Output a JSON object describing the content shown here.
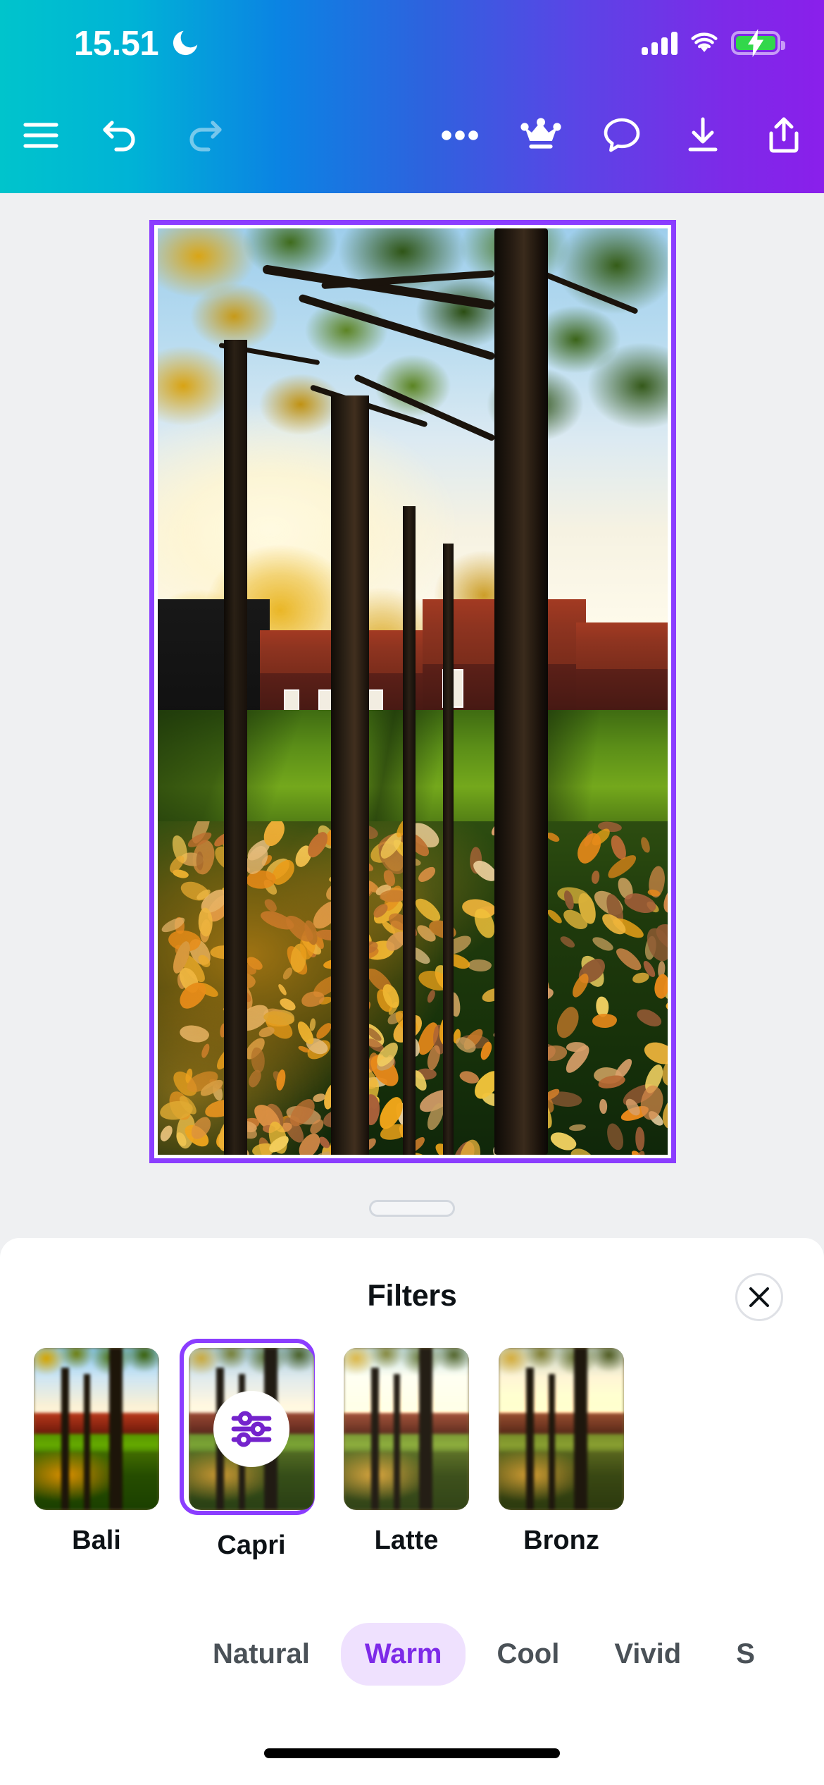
{
  "status": {
    "time": "15.51",
    "dnd_icon": "moon-icon",
    "signal_icon": "cellular-signal-icon",
    "wifi_icon": "wifi-icon",
    "battery_icon": "battery-charging-icon",
    "battery_color": "#32D74B"
  },
  "toolbar": {
    "menu_label": "menu-icon",
    "undo_label": "undo-icon",
    "redo_label": "redo-icon",
    "more_label": "more-icon",
    "crown_label": "crown-icon",
    "comment_label": "comment-icon",
    "download_label": "download-icon",
    "share_label": "share-icon"
  },
  "canvas": {
    "selection_color": "#8B3DFF",
    "background_color": "#EFF0F2",
    "image_description": "Autumn park with yellow maple leaves on grass and red-roofed houses"
  },
  "sheet": {
    "title": "Filters",
    "close_label": "✕",
    "filters": [
      {
        "name": "Bali",
        "selected": false
      },
      {
        "name": "Capri",
        "selected": true
      },
      {
        "name": "Latte",
        "selected": false
      },
      {
        "name": "Bronz",
        "selected": false
      }
    ],
    "adjust_icon": "sliders-icon",
    "categories": [
      {
        "label": "Natural",
        "active": false
      },
      {
        "label": "Warm",
        "active": true
      },
      {
        "label": "Cool",
        "active": false
      },
      {
        "label": "Vivid",
        "active": false
      },
      {
        "label": "S",
        "active": false
      }
    ],
    "accent_color": "#7D2AE8",
    "active_pill_color": "#EFE1FE"
  }
}
